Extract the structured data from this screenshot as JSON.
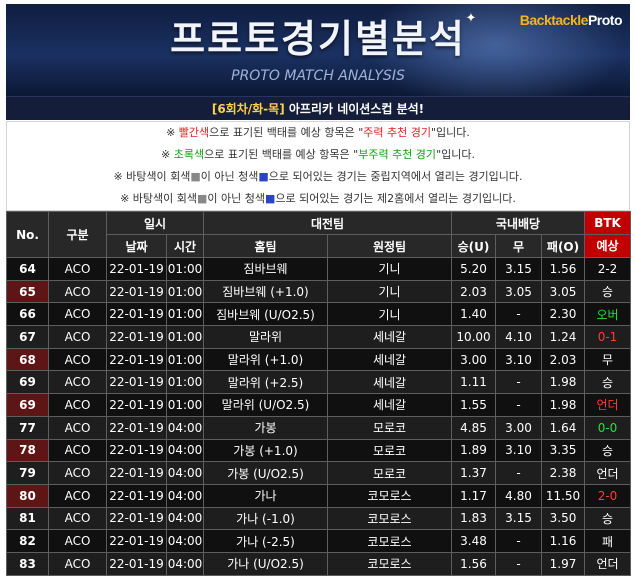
{
  "banner": {
    "title": "프로토경기별분석",
    "subtitle": "PROTO MATCH ANALYSIS",
    "brand_main": "Backtackle",
    "brand_alt": "Proto"
  },
  "subbar": {
    "round": "[6회차/화-목]",
    "rest": " 아프리카 네이션스컵 분석!"
  },
  "notes": [
    {
      "parts": [
        {
          "t": "※ ",
          "c": ""
        },
        {
          "t": "빨간색",
          "c": "red"
        },
        {
          "t": "으로 표기된 백태를 예상 항목은 \"",
          "c": ""
        },
        {
          "t": "주력 추천 경기",
          "c": "red"
        },
        {
          "t": "\"입니다.",
          "c": ""
        }
      ]
    },
    {
      "parts": [
        {
          "t": "※ ",
          "c": ""
        },
        {
          "t": "초록색",
          "c": "green"
        },
        {
          "t": "으로 표기된 백태를 예상 항목은 \"",
          "c": ""
        },
        {
          "t": "부주력 추천 경기",
          "c": "green"
        },
        {
          "t": "\"입니다.",
          "c": ""
        }
      ]
    },
    {
      "parts": [
        {
          "t": "※ 바탕색이 회색",
          "c": ""
        },
        {
          "t": "■",
          "c": "grey"
        },
        {
          "t": "이 아닌 청색",
          "c": ""
        },
        {
          "t": "■",
          "c": "blue"
        },
        {
          "t": "으로 되어있는 경기는 중립지역에서 열리는 경기입니다.",
          "c": ""
        }
      ]
    },
    {
      "parts": [
        {
          "t": "※ 바탕색이 회색",
          "c": ""
        },
        {
          "t": "■",
          "c": "grey"
        },
        {
          "t": "이 아닌 청색",
          "c": ""
        },
        {
          "t": "■",
          "c": "blue"
        },
        {
          "t": "으로 되어있는 경기는 제2홈에서 열리는 경기입니다.",
          "c": ""
        }
      ]
    }
  ],
  "table": {
    "headers": {
      "no": "No.",
      "type": "구분",
      "datetime": "일시",
      "date": "날짜",
      "time": "시간",
      "matchup": "대전팀",
      "home": "홈팀",
      "away": "원정팀",
      "odds": "국내배당",
      "win": "승(U)",
      "draw": "무",
      "lose": "패(O)",
      "btk": "BTK",
      "pick": "예상"
    },
    "rows": [
      {
        "no": "64",
        "type": "ACO",
        "date": "22-01-19",
        "time": "01:00",
        "home": "짐바브웨",
        "away": "기니",
        "win": "5.20",
        "draw": "3.15",
        "lose": "1.56",
        "pick": "2-2",
        "pick_color": "",
        "no_bg": ""
      },
      {
        "no": "65",
        "type": "ACO",
        "date": "22-01-19",
        "time": "01:00",
        "home": "짐바브웨 (+1.0)",
        "away": "기니",
        "win": "2.03",
        "draw": "3.05",
        "lose": "3.05",
        "pick": "승",
        "pick_color": "",
        "no_bg": "rn"
      },
      {
        "no": "66",
        "type": "ACO",
        "date": "22-01-19",
        "time": "01:00",
        "home": "짐바브웨 (U/O2.5)",
        "away": "기니",
        "win": "1.40",
        "draw": "-",
        "lose": "2.30",
        "pick": "오버",
        "pick_color": "pick-green",
        "no_bg": ""
      },
      {
        "no": "67",
        "type": "ACO",
        "date": "22-01-19",
        "time": "01:00",
        "home": "말라위",
        "away": "세네갈",
        "win": "10.00",
        "draw": "4.10",
        "lose": "1.24",
        "pick": "0-1",
        "pick_color": "pick-red",
        "no_bg": ""
      },
      {
        "no": "68",
        "type": "ACO",
        "date": "22-01-19",
        "time": "01:00",
        "home": "말라위 (+1.0)",
        "away": "세네갈",
        "win": "3.00",
        "draw": "3.10",
        "lose": "2.03",
        "pick": "무",
        "pick_color": "",
        "no_bg": "rn"
      },
      {
        "no": "69",
        "type": "ACO",
        "date": "22-01-19",
        "time": "01:00",
        "home": "말라위 (+2.5)",
        "away": "세네갈",
        "win": "1.11",
        "draw": "-",
        "lose": "1.98",
        "pick": "승",
        "pick_color": "",
        "no_bg": ""
      },
      {
        "no": "69",
        "type": "ACO",
        "date": "22-01-19",
        "time": "01:00",
        "home": "말라위 (U/O2.5)",
        "away": "세네갈",
        "win": "1.55",
        "draw": "-",
        "lose": "1.98",
        "pick": "언더",
        "pick_color": "pick-red",
        "no_bg": "rn"
      },
      {
        "no": "77",
        "type": "ACO",
        "date": "22-01-19",
        "time": "04:00",
        "home": "가봉",
        "away": "모로코",
        "win": "4.85",
        "draw": "3.00",
        "lose": "1.64",
        "pick": "0-0",
        "pick_color": "pick-green",
        "no_bg": ""
      },
      {
        "no": "78",
        "type": "ACO",
        "date": "22-01-19",
        "time": "04:00",
        "home": "가봉 (+1.0)",
        "away": "모로코",
        "win": "1.89",
        "draw": "3.10",
        "lose": "3.35",
        "pick": "승",
        "pick_color": "",
        "no_bg": "rn"
      },
      {
        "no": "79",
        "type": "ACO",
        "date": "22-01-19",
        "time": "04:00",
        "home": "가봉 (U/O2.5)",
        "away": "모로코",
        "win": "1.37",
        "draw": "-",
        "lose": "2.38",
        "pick": "언더",
        "pick_color": "",
        "no_bg": ""
      },
      {
        "no": "80",
        "type": "ACO",
        "date": "22-01-19",
        "time": "04:00",
        "home": "가나",
        "away": "코모로스",
        "win": "1.17",
        "draw": "4.80",
        "lose": "11.50",
        "pick": "2-0",
        "pick_color": "pick-red",
        "no_bg": "rn"
      },
      {
        "no": "81",
        "type": "ACO",
        "date": "22-01-19",
        "time": "04:00",
        "home": "가나 (-1.0)",
        "away": "코모로스",
        "win": "1.83",
        "draw": "3.15",
        "lose": "3.50",
        "pick": "승",
        "pick_color": "",
        "no_bg": ""
      },
      {
        "no": "82",
        "type": "ACO",
        "date": "22-01-19",
        "time": "04:00",
        "home": "가나 (-2.5)",
        "away": "코모로스",
        "win": "3.48",
        "draw": "-",
        "lose": "1.16",
        "pick": "패",
        "pick_color": "",
        "no_bg": ""
      },
      {
        "no": "83",
        "type": "ACO",
        "date": "22-01-19",
        "time": "04:00",
        "home": "가나 (U/O2.5)",
        "away": "코모로스",
        "win": "1.56",
        "draw": "-",
        "lose": "1.97",
        "pick": "언더",
        "pick_color": "",
        "no_bg": ""
      }
    ]
  }
}
